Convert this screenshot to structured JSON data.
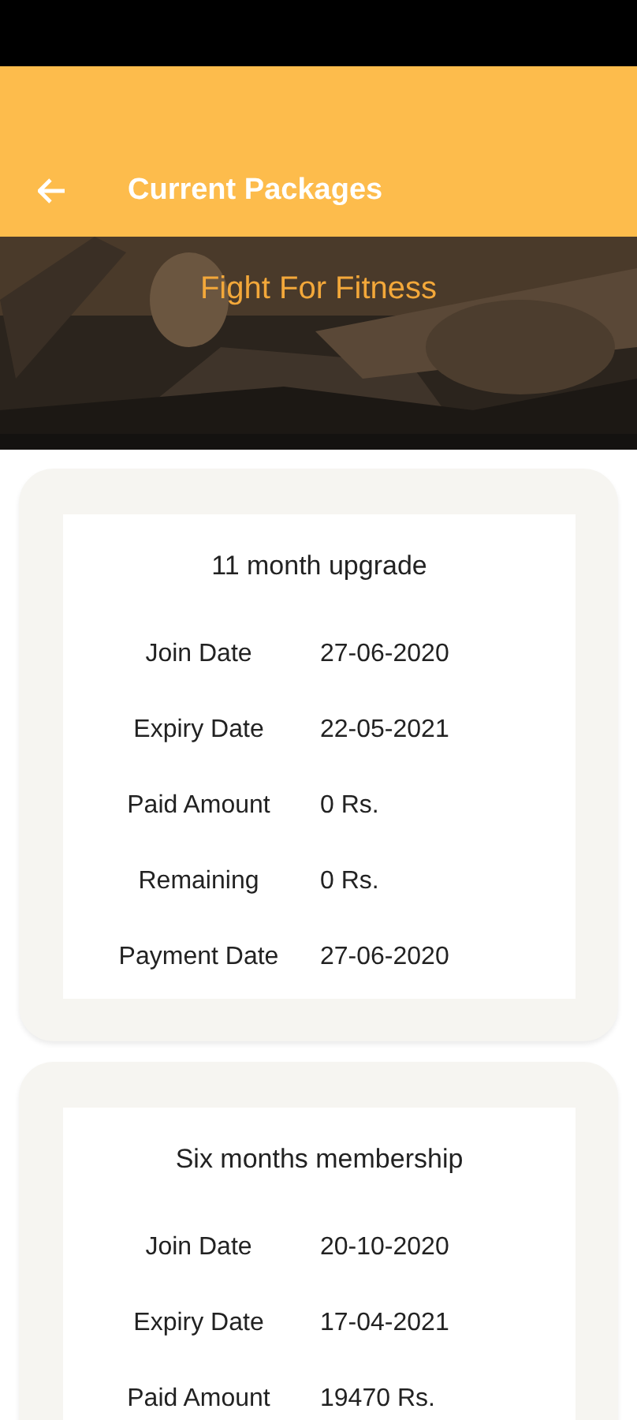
{
  "header": {
    "title": "Current Packages"
  },
  "banner": {
    "title": "Fight For Fitness",
    "kind": "picture"
  },
  "packages": [
    {
      "name": "11 month upgrade",
      "rows": [
        {
          "label": "Join Date",
          "value": "27-06-2020"
        },
        {
          "label": "Expiry Date",
          "value": "22-05-2021"
        },
        {
          "label": "Paid Amount",
          "value": "0 Rs."
        },
        {
          "label": "Remaining",
          "value": "0 Rs."
        },
        {
          "label": "Payment Date",
          "value": "27-06-2020"
        }
      ]
    },
    {
      "name": "Six months membership",
      "rows": [
        {
          "label": "Join Date",
          "value": "20-10-2020"
        },
        {
          "label": "Expiry Date",
          "value": "17-04-2021"
        },
        {
          "label": "Paid Amount",
          "value": "19470 Rs."
        }
      ]
    }
  ]
}
